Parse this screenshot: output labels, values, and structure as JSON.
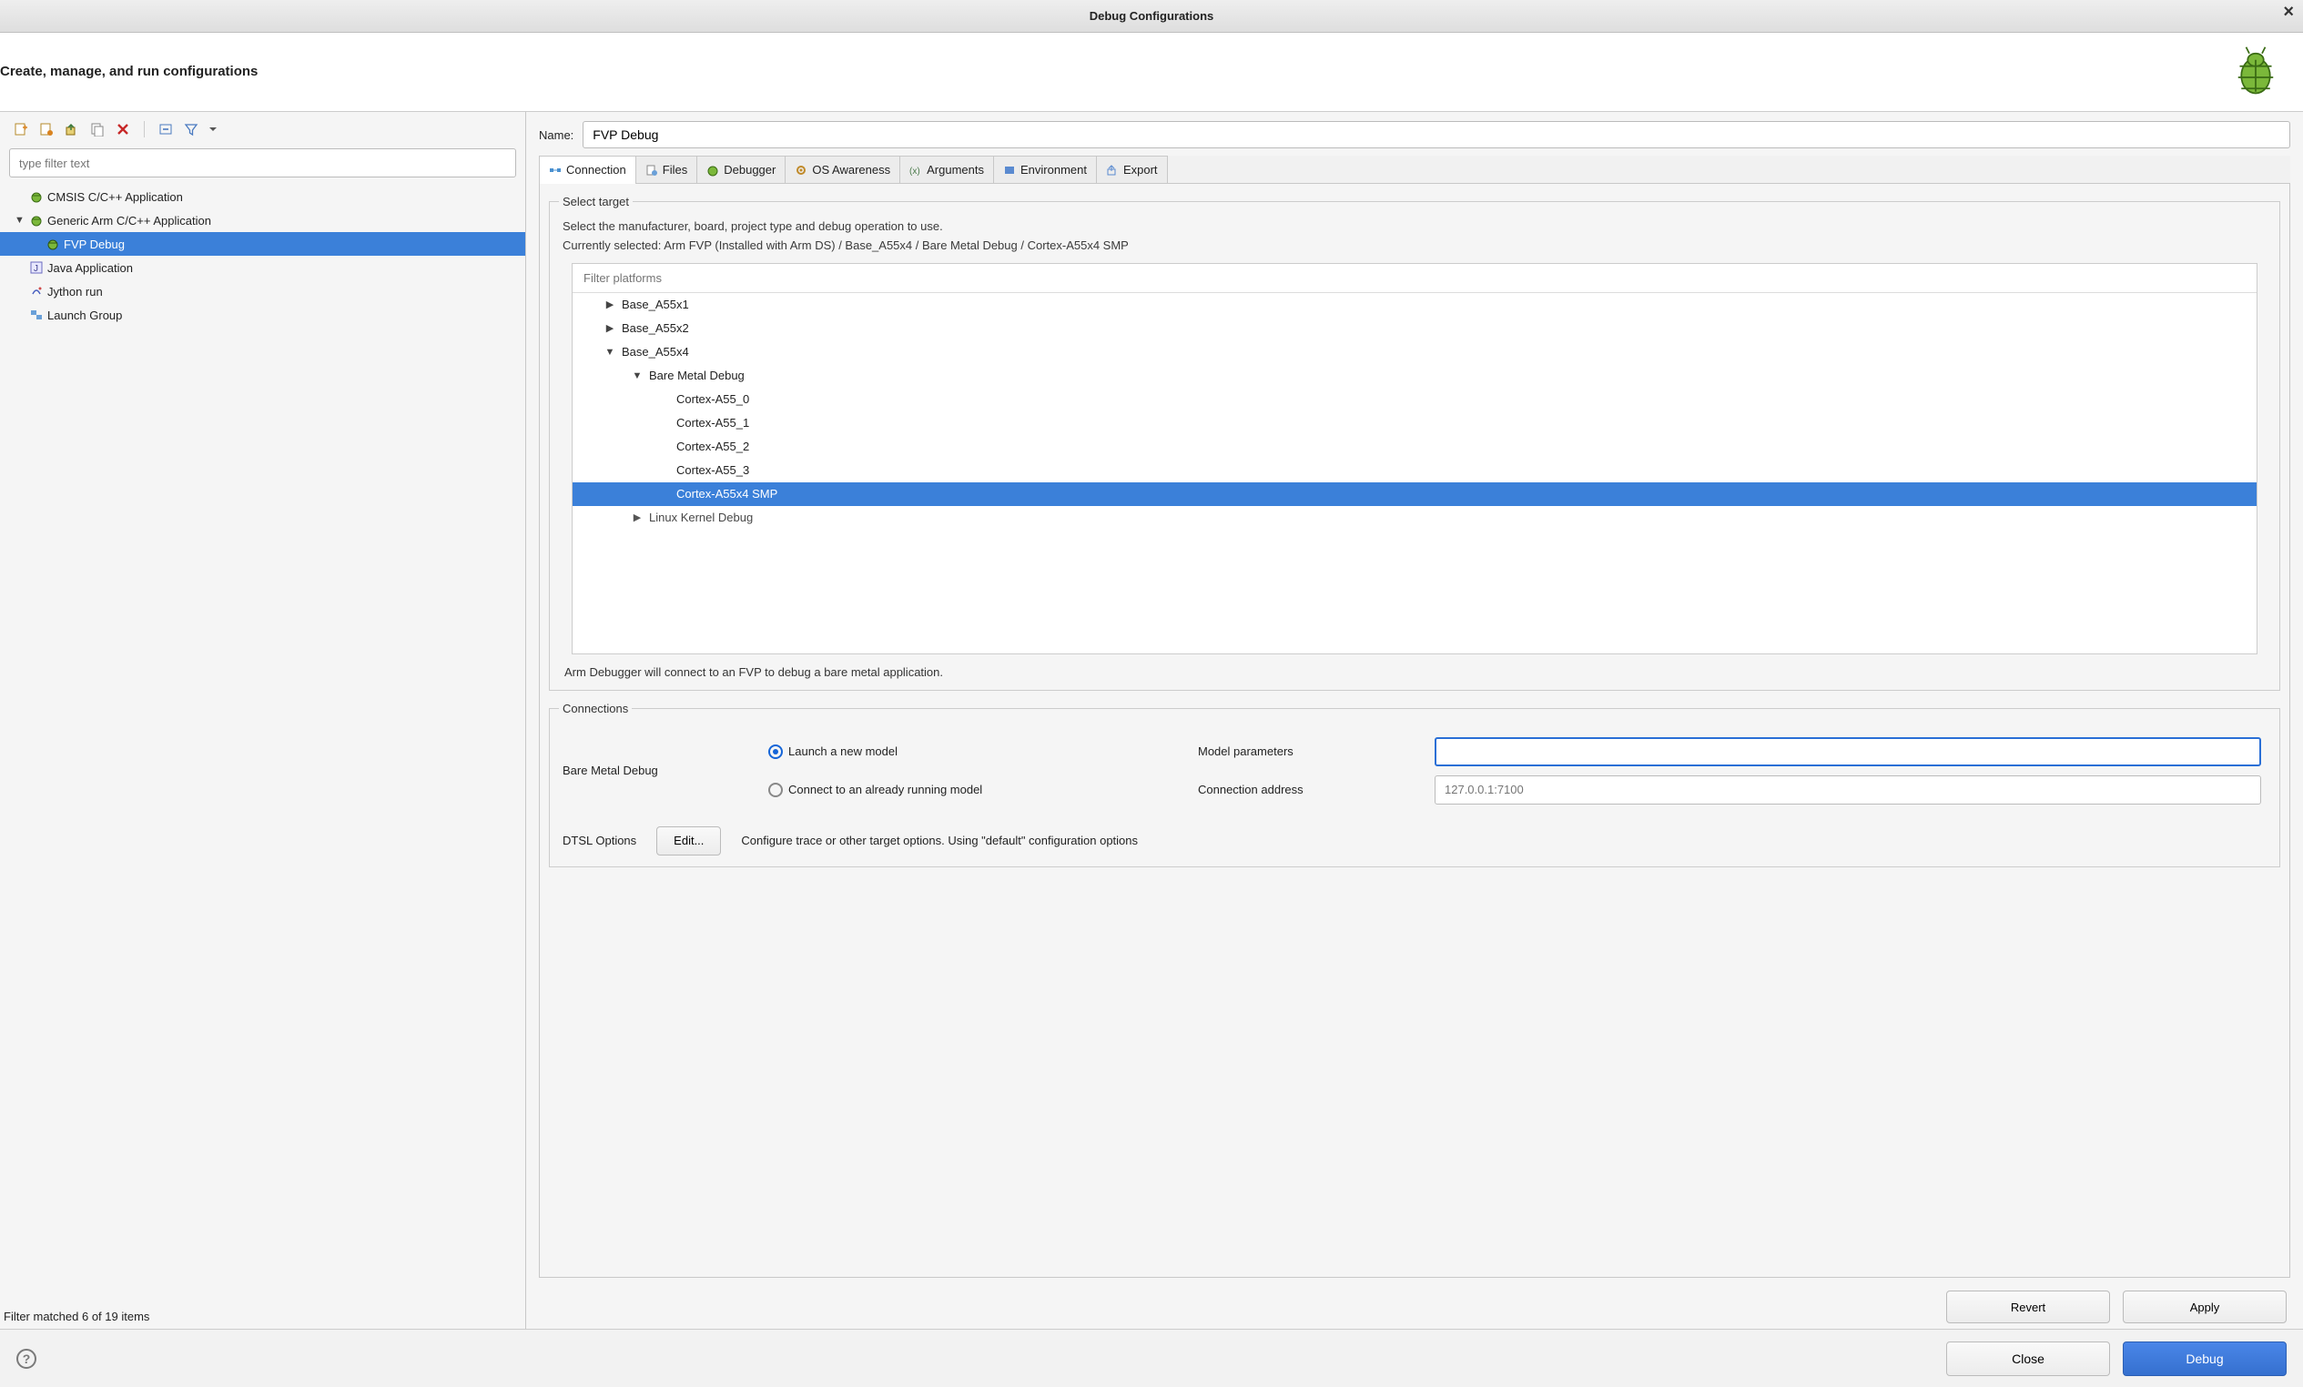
{
  "window": {
    "title": "Debug Configurations"
  },
  "header": {
    "subtitle": "Create, manage, and run configurations"
  },
  "sidebar": {
    "filter_placeholder": "type filter text",
    "items": [
      {
        "label": "CMSIS C/C++ Application",
        "expandable": false,
        "icon": "bug"
      },
      {
        "label": "Generic Arm C/C++ Application",
        "expandable": true,
        "expanded": true,
        "icon": "bug",
        "children": [
          {
            "label": "FVP Debug",
            "icon": "bug",
            "selected": true
          }
        ]
      },
      {
        "label": "Java Application",
        "expandable": false,
        "icon": "j"
      },
      {
        "label": "Jython run",
        "expandable": false,
        "icon": "jy"
      },
      {
        "label": "Launch Group",
        "expandable": false,
        "icon": "grp"
      }
    ],
    "footer": "Filter matched 6 of 19 items"
  },
  "main": {
    "name_label": "Name:",
    "name_value": "FVP Debug",
    "tabs": [
      {
        "label": "Connection",
        "active": true
      },
      {
        "label": "Files"
      },
      {
        "label": "Debugger"
      },
      {
        "label": "OS Awareness"
      },
      {
        "label": "Arguments"
      },
      {
        "label": "Environment"
      },
      {
        "label": "Export"
      }
    ],
    "select_target": {
      "legend": "Select target",
      "desc_line1": "Select the manufacturer, board, project type and debug operation to use.",
      "desc_line2": "Currently selected: Arm FVP (Installed with Arm DS) / Base_A55x4 / Bare Metal Debug / Cortex-A55x4 SMP",
      "filter_placeholder": "Filter platforms",
      "tree": [
        {
          "label": "Base_A55x1",
          "depth": 1,
          "exp": "▶"
        },
        {
          "label": "Base_A55x2",
          "depth": 1,
          "exp": "▶"
        },
        {
          "label": "Base_A55x4",
          "depth": 1,
          "exp": "▼"
        },
        {
          "label": "Bare Metal Debug",
          "depth": 2,
          "exp": "▼"
        },
        {
          "label": "Cortex-A55_0",
          "depth": 3,
          "exp": ""
        },
        {
          "label": "Cortex-A55_1",
          "depth": 3,
          "exp": ""
        },
        {
          "label": "Cortex-A55_2",
          "depth": 3,
          "exp": ""
        },
        {
          "label": "Cortex-A55_3",
          "depth": 3,
          "exp": ""
        },
        {
          "label": "Cortex-A55x4 SMP",
          "depth": 3,
          "exp": "",
          "selected": true
        },
        {
          "label": "Linux Kernel Debug",
          "depth": 2,
          "exp": "▶",
          "cutoff": true
        }
      ],
      "dbg_desc": "Arm Debugger will connect to an FVP to debug a bare metal application."
    },
    "connections": {
      "legend": "Connections",
      "row_label": "Bare Metal Debug",
      "opt1_label": "Launch a new model",
      "opt1_param_label": "Model parameters",
      "opt1_param_value": "",
      "opt2_label": "Connect to an already running model",
      "opt2_addr_label": "Connection address",
      "opt2_addr_placeholder": "127.0.0.1:7100",
      "dtsl_label": "DTSL Options",
      "dtsl_edit": "Edit...",
      "dtsl_desc": "Configure  trace or other target options. Using \"default\" configuration options"
    },
    "actions": {
      "revert": "Revert",
      "apply": "Apply"
    }
  },
  "footer": {
    "close": "Close",
    "debug": "Debug"
  }
}
